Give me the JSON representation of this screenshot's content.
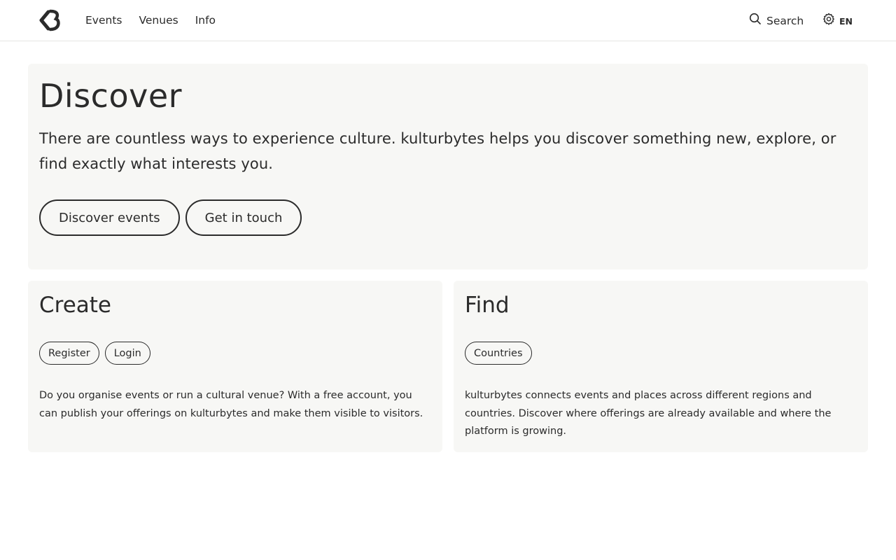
{
  "header": {
    "logo_alt": "kulturbytes",
    "nav": [
      {
        "label": "Events"
      },
      {
        "label": "Venues"
      },
      {
        "label": "Info"
      }
    ],
    "search_label": "Search",
    "language_label": "EN"
  },
  "hero": {
    "title": "Discover",
    "text": "There are countless ways to experience culture. kulturbytes helps you discover something new, explore, or find exactly what interests you.",
    "buttons": [
      {
        "label": "Discover events"
      },
      {
        "label": "Get in touch"
      }
    ]
  },
  "create": {
    "title": "Create",
    "buttons": [
      {
        "label": "Register"
      },
      {
        "label": "Login"
      }
    ],
    "text": "Do you organise events or run a cultural venue? With a free account, you can publish your offerings on kulturbytes and make them visible to visitors."
  },
  "find": {
    "title": "Find",
    "buttons": [
      {
        "label": "Countries"
      }
    ],
    "text": "kulturbytes connects events and places across different regions and countries. Discover where offerings are already available and where the platform is growing."
  },
  "colors": {
    "text": "#2b2b2b",
    "panel_bg": "#f7f7f5",
    "border": "#e6e6e3"
  }
}
